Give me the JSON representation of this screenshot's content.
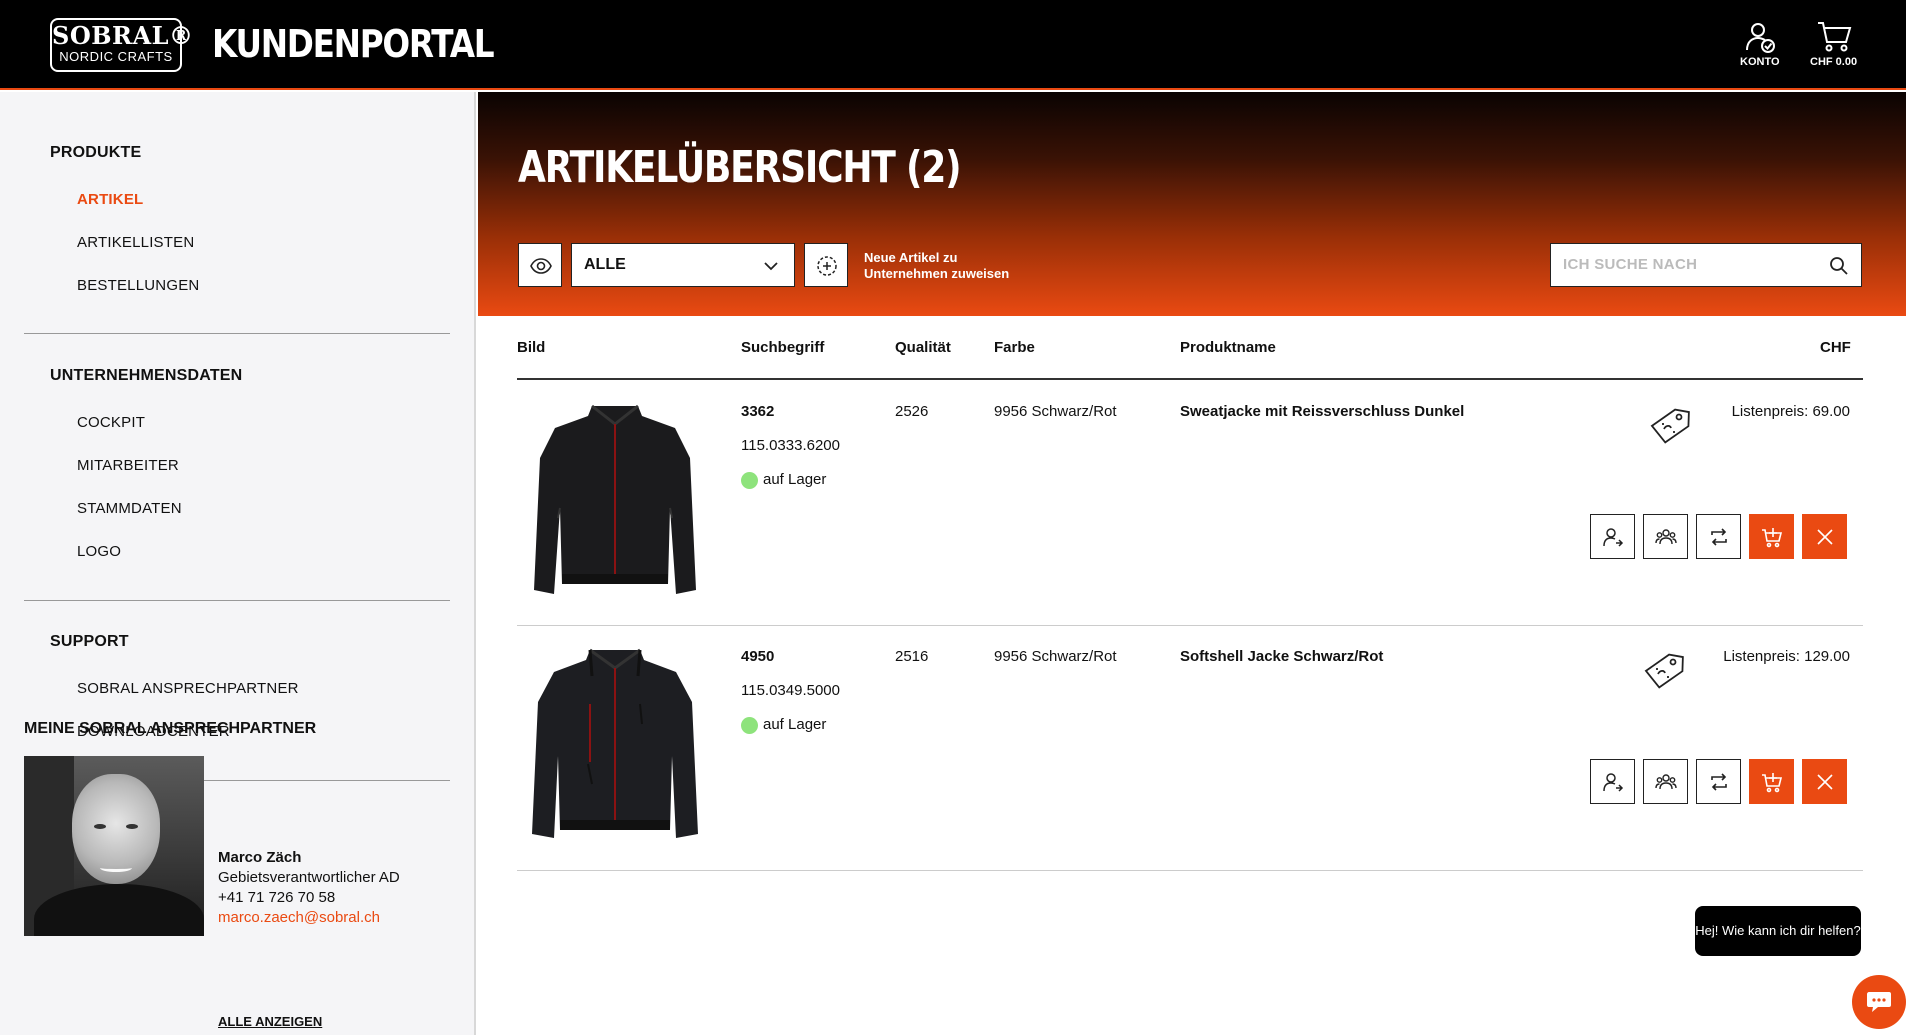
{
  "header": {
    "logo_main": "SOBRAL®",
    "logo_sub": "NORDIC CRAFTS",
    "portal_title": "KUNDENPORTAL",
    "account_label": "KONTO",
    "cart_label": "CHF 0.00"
  },
  "sidebar": {
    "sections": [
      {
        "title": "PRODUKTE",
        "items": [
          "ARTIKEL",
          "ARTIKELLISTEN",
          "BESTELLUNGEN"
        ]
      },
      {
        "title": "UNTERNEHMENSDATEN",
        "items": [
          "COCKPIT",
          "MITARBEITER",
          "STAMMDATEN",
          "LOGO"
        ]
      },
      {
        "title": "SUPPORT",
        "items": [
          "SOBRAL ANSPRECHPARTNER",
          "DOWNLOADCENTER"
        ]
      }
    ],
    "active_item": "ARTIKEL",
    "contact": {
      "heading": "MEINE SOBRAL ANSPRECHPARTNER",
      "name": "Marco Zäch",
      "role": "Gebietsverantwortlicher AD",
      "phone": "+41 71 726 70 58",
      "email": "marco.zaech@sobral.ch",
      "show_all": "ALLE ANZEIGEN"
    }
  },
  "main": {
    "title": "ARTIKELÜBERSICHT (2)",
    "filter": {
      "selected": "ALLE"
    },
    "assign_text_1": "Neue Artikel zu",
    "assign_text_2": "Unternehmen zuweisen",
    "search_placeholder": "ICH SUCHE NACH",
    "columns": [
      "Bild",
      "Suchbegriff",
      "Qualität",
      "Farbe",
      "Produktname",
      "CHF"
    ],
    "rows": [
      {
        "search_term": "3362",
        "article_no": "115.0333.6200",
        "stock": "auf Lager",
        "quality": "2526",
        "color": "9956 Schwarz/Rot",
        "product_name": "Sweatjacke mit Reissverschluss Dunkel",
        "price": "Listenpreis: 69.00"
      },
      {
        "search_term": "4950",
        "article_no": "115.0349.5000",
        "stock": "auf Lager",
        "quality": "2516",
        "color": "9956 Schwarz/Rot",
        "product_name": "Softshell Jacke Schwarz/Rot",
        "price": "Listenpreis: 129.00"
      }
    ]
  },
  "chat": {
    "bubble_text": "Hej! Wie kann ich dir helfen?"
  },
  "colors": {
    "accent": "#ea4a12",
    "header_bg": "#000000",
    "sidebar_bg": "#f5f5f7",
    "stock_green": "#8ee37c"
  },
  "icons": [
    "account-icon",
    "cart-icon",
    "eye-icon",
    "chevron-down-icon",
    "assign-icon",
    "search-icon",
    "price-tag-icon",
    "user-assign-icon",
    "group-icon",
    "swap-icon",
    "add-to-cart-icon",
    "close-icon",
    "chat-icon"
  ]
}
